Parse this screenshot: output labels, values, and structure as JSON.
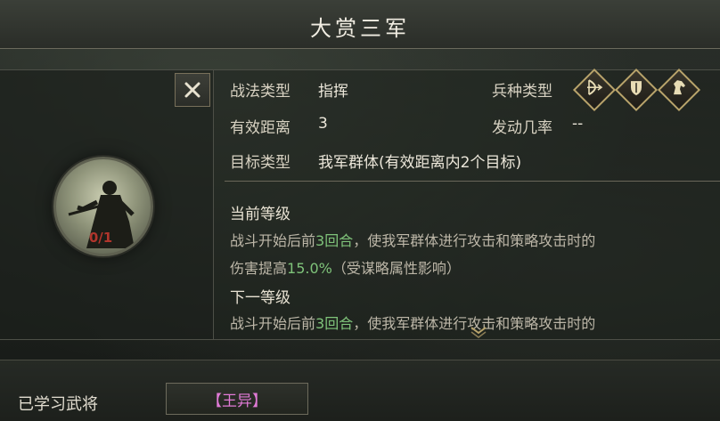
{
  "title": "大赏三军",
  "portrait": {
    "count": "0/1"
  },
  "info": {
    "tactic_type_label": "战法类型",
    "tactic_type_value": "指挥",
    "troop_type_label": "兵种类型",
    "range_label": "有效距离",
    "range_value": "3",
    "trigger_rate_label": "发动几率",
    "trigger_rate_value": "--",
    "target_type_label": "目标类型",
    "target_type_value": "我军群体(有效距离内2个目标)"
  },
  "troop_icons": [
    "bow-icon",
    "shield-icon",
    "horse-icon"
  ],
  "current_level": {
    "title": "当前等级",
    "line1_pre": "战斗开始后前",
    "line1_hl": "3回合",
    "line1_post": "，使我军群体进行攻击和策略攻击时的",
    "line2_pre": "伤害提高",
    "line2_hl": "15.0%",
    "line2_post": "（受谋略属性影响）"
  },
  "next_level": {
    "title": "下一等级",
    "line1_pre": "战斗开始后前",
    "line1_hl": "3回合",
    "line1_post": "，使我军群体进行攻击和策略攻击时的"
  },
  "bottom": {
    "learned_label": "已学习武将",
    "general_name": "【王异】"
  },
  "colors": {
    "highlight": "#7fc37a",
    "general_name": "#e07ad6",
    "count": "#b0352c",
    "troop_border": "#b9a46b"
  }
}
